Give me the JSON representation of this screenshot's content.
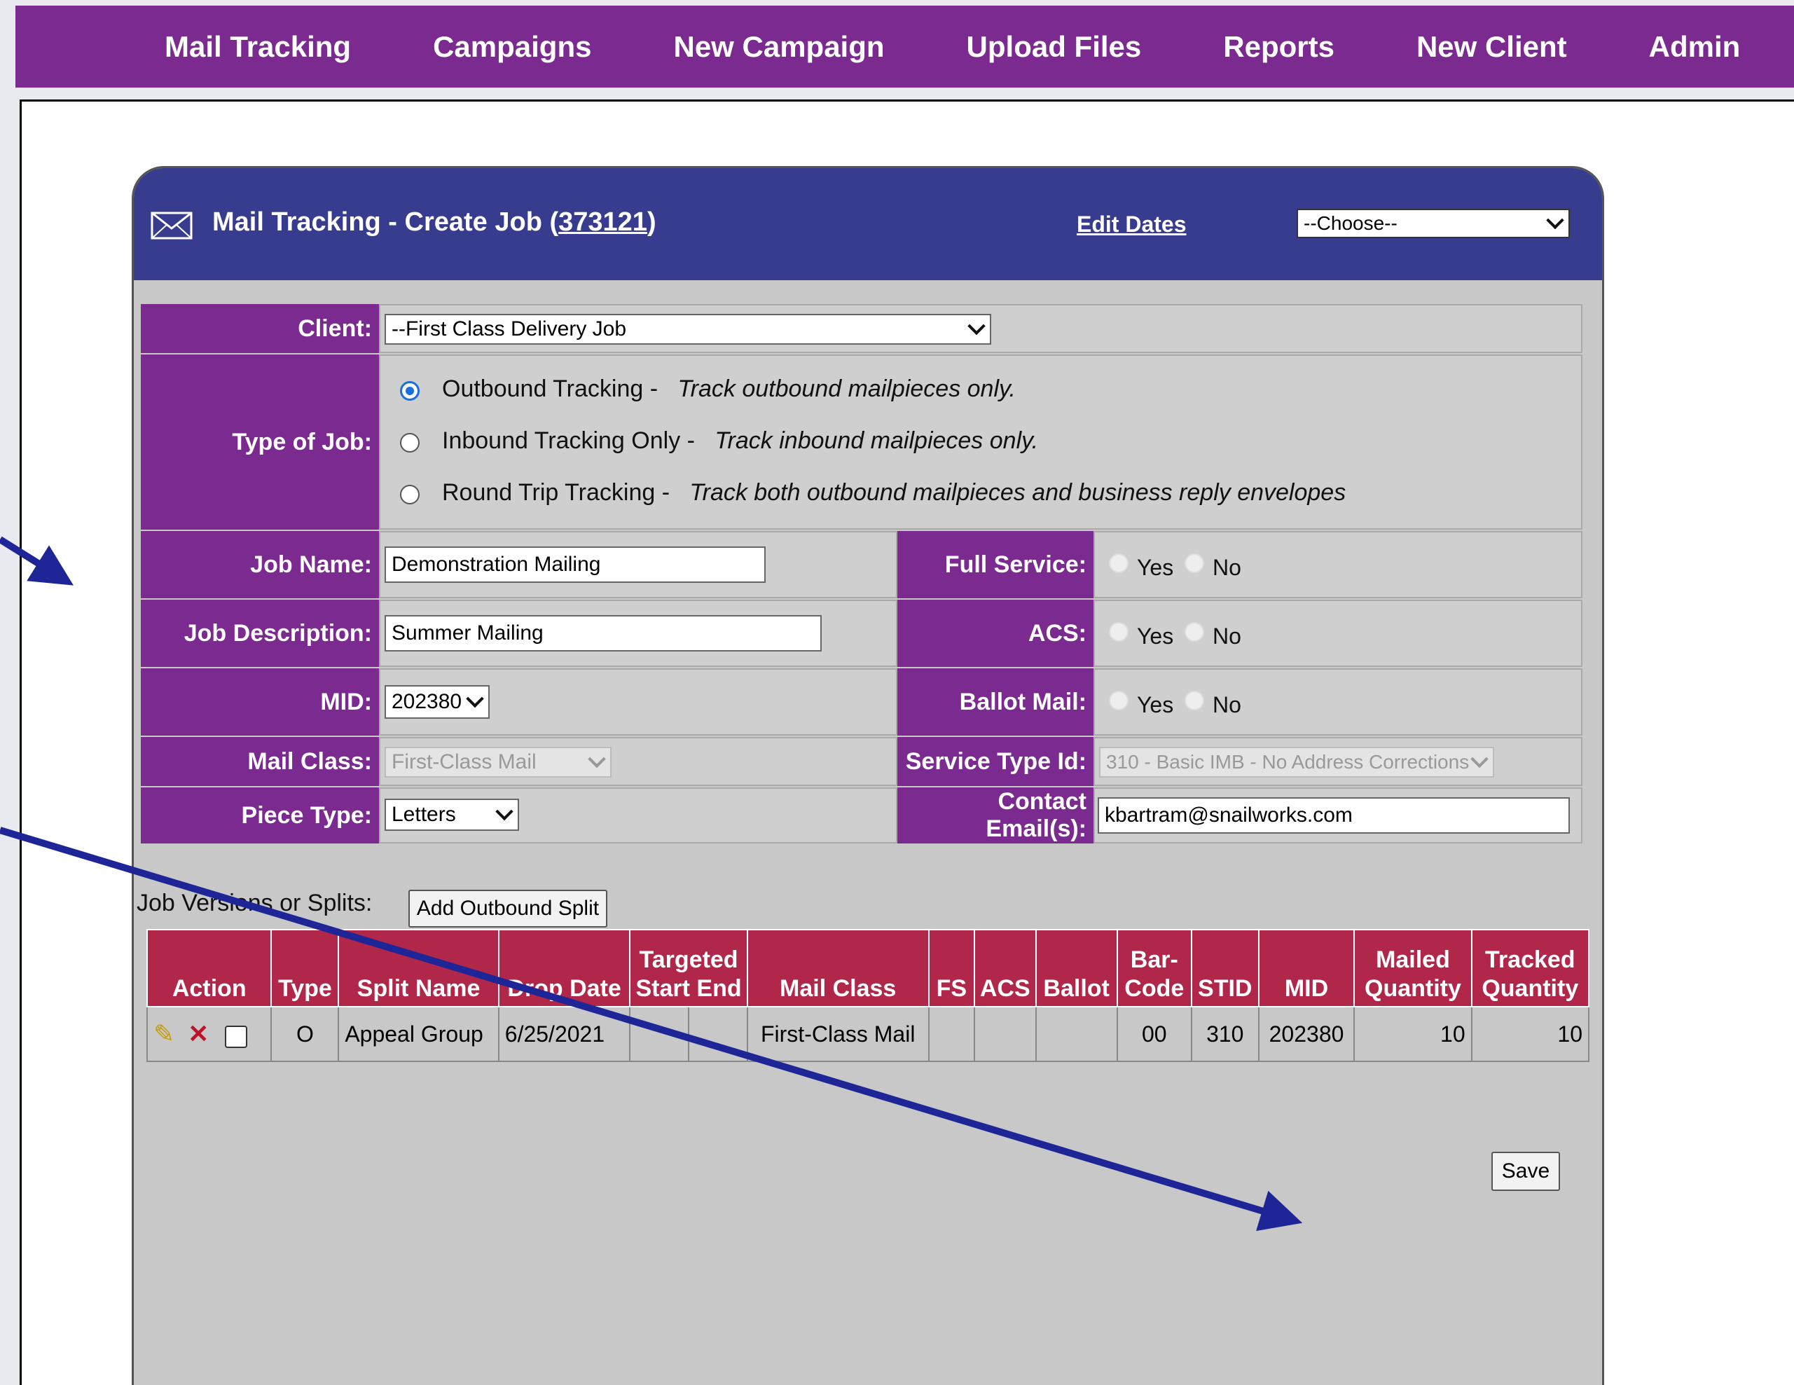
{
  "nav": {
    "items": [
      "Mail Tracking",
      "Campaigns",
      "New Campaign",
      "Upload Files",
      "Reports",
      "New Client",
      "Admin"
    ]
  },
  "panel": {
    "title_prefix": "Mail Tracking - Create Job (",
    "job_id": "373121",
    "title_suffix": ")",
    "edit_dates": "Edit Dates",
    "choose_value": "--Choose--"
  },
  "form": {
    "client_label": "Client:",
    "client_value": "--First Class Delivery Job",
    "type_label": "Type of Job:",
    "job_types": [
      {
        "name": "Outbound Tracking -",
        "desc": "Track outbound mailpieces only.",
        "checked": true
      },
      {
        "name": "Inbound Tracking Only -",
        "desc": "Track inbound mailpieces only.",
        "checked": false
      },
      {
        "name": "Round Trip Tracking -",
        "desc": "Track both outbound mailpieces and business reply envelopes",
        "checked": false
      }
    ],
    "job_name_label": "Job Name:",
    "job_name_value": "Demonstration Mailing",
    "job_desc_label": "Job Description:",
    "job_desc_value": "Summer Mailing",
    "mid_label": "MID:",
    "mid_value": "202380",
    "mail_class_label": "Mail Class:",
    "mail_class_value": "First-Class Mail",
    "piece_type_label": "Piece Type:",
    "piece_type_value": "Letters",
    "full_service_label": "Full Service:",
    "acs_label": "ACS:",
    "ballot_label": "Ballot Mail:",
    "yes": "Yes",
    "no": "No",
    "service_type_label": "Service Type Id:",
    "service_type_value": "310 - Basic IMB - No Address Corrections",
    "contact_email_label": "Contact Email(s):",
    "contact_email_value": "kbartram@snailworks.com"
  },
  "splits": {
    "label": "Job Versions or Splits:",
    "add_button": "Add Outbound Split",
    "headers": {
      "action": "Action",
      "type": "Type",
      "split_name": "Split Name",
      "drop_date": "Drop Date",
      "targeted_1": "Targeted",
      "targeted_2": "Start End",
      "mail_class": "Mail Class",
      "fs": "FS",
      "acs": "ACS",
      "ballot": "Ballot",
      "barcode_1": "Bar-",
      "barcode_2": "Code",
      "stid": "STID",
      "mid": "MID",
      "mailed_1": "Mailed",
      "mailed_2": "Quantity",
      "tracked_1": "Tracked",
      "tracked_2": "Quantity"
    },
    "row": {
      "type": "O",
      "split_name": "Appeal Group",
      "drop_date": "6/25/2021",
      "start": "",
      "end": "",
      "mail_class": "First-Class Mail",
      "fs": "",
      "acs": "",
      "ballot": "",
      "barcode": "00",
      "stid": "310",
      "mid": "202380",
      "mailed": "10",
      "tracked": "10"
    }
  },
  "save_button": "Save",
  "colors": {
    "nav": "#7b2a8f",
    "panel_header": "#383c8e",
    "label_bg": "#7b2a8f",
    "table_header": "#b1274a",
    "arrow": "#1e2596"
  }
}
